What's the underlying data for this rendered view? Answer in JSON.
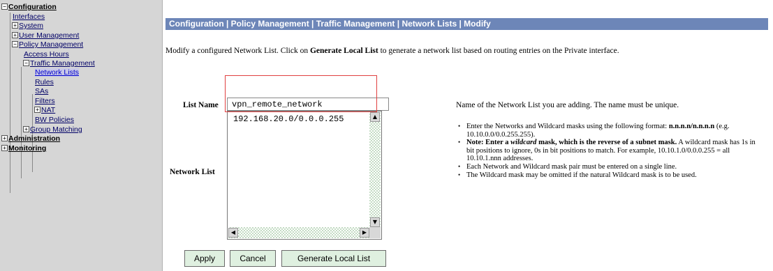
{
  "sidebar": {
    "configuration": "Configuration",
    "interfaces": "Interfaces",
    "system": "System",
    "user_management": "User Management",
    "policy_management": "Policy Management",
    "access_hours": "Access Hours",
    "traffic_management": "Traffic Management",
    "network_lists": "Network Lists",
    "rules": "Rules",
    "sas": "SAs",
    "filters": "Filters",
    "nat": "NAT",
    "bw_policies": "BW Policies",
    "group_matching": "Group Matching",
    "administration": "Administration",
    "monitoring": "Monitoring",
    "expand_symbol": "+",
    "collapse_symbol": "−"
  },
  "main": {
    "title": "Configuration | Policy Management | Traffic Management | Network Lists | Modify",
    "intro": {
      "before": "Modify a configured Network List. Click on ",
      "bold": "Generate Local List",
      "after": " to generate a network list based on routing entries on the Private interface."
    },
    "list_name_label": "List Name",
    "list_name_value": "vpn_remote_network",
    "list_name_help": "Name of the Network List you are adding. The name must be unique.",
    "network_list_label": "Network List",
    "network_list_value": "192.168.20.0/0.0.0.255",
    "help": {
      "b1_text": "Enter the Networks and Wildcard masks using the following format:",
      "b1_bold": "n.n.n.n/n.n.n.n",
      "b1_example": "(e.g. 10.10.0.0/0.0.255.255).",
      "b2_note_a": "Note: Enter a ",
      "b2_note_italic": "wildcard",
      "b2_note_b": " mask, which is the reverse of a subnet mask.",
      "b2_rest": "A wildcard mask has 1s in bit positions to ignore, 0s in bit positions to match. For example, 10.10.1.0/0.0.0.255 = all 10.10.1.nnn addresses.",
      "b3": "Each Network and Wildcard mask pair must be entered on a single line.",
      "b4": "The Wildcard mask may be omitted if the natural Wildcard mask is to be used."
    },
    "buttons": {
      "apply": "Apply",
      "cancel": "Cancel",
      "generate": "Generate Local List"
    }
  },
  "scroll_icons": {
    "up": "▲",
    "down": "▼",
    "left": "◀",
    "right": "▶"
  },
  "colors": {
    "title_bar": "#6d86b8",
    "sidebar_bg": "#d6d6d6",
    "button_bg": "#dff0e0",
    "highlight": "#e04040"
  }
}
